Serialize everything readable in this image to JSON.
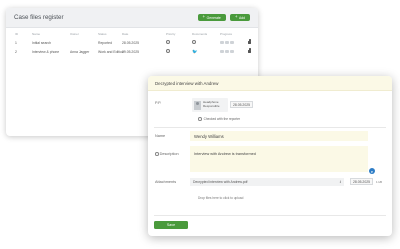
{
  "register": {
    "title": "Case files register",
    "buttons": [
      {
        "label": "Generate"
      },
      {
        "label": "Add"
      }
    ],
    "columns": [
      "ID",
      "Name",
      "Owner",
      "Status",
      "Date",
      "Priority",
      "Documents",
      "Progress",
      ""
    ],
    "rows": [
      {
        "idx": "1",
        "name": "Initial search",
        "owner": "",
        "status": "Reported",
        "date": "28.05.2025"
      },
      {
        "idx": "2",
        "name": "Interview & phone",
        "owner": "Anna Jagger",
        "status": "Work and Edition",
        "date": "29.05.2025"
      }
    ]
  },
  "card": {
    "title": "Decrypted interview with Andrew",
    "person_label": "P.P.",
    "person_name": "Headphone",
    "person_role": "Responsible",
    "date1": "28.05.2025",
    "check_label": "Checked with the reporter",
    "name_label": "Name",
    "name_value": "Wendy Williams",
    "desc_label": "Description",
    "desc_value": "Interview with Andrew is transformed",
    "attach_label": "Attachments",
    "attach_value": "Decrypted interview with Andrew.pdf",
    "attach_date": "28.05.2025",
    "attach_size": "1 kB",
    "drop_text": "Drop files here to click to upload",
    "save_label": "Save"
  },
  "colors": {
    "accent": "#4a9a3c",
    "highlight": "#fbf9e6",
    "help": "#2e7dc6"
  }
}
